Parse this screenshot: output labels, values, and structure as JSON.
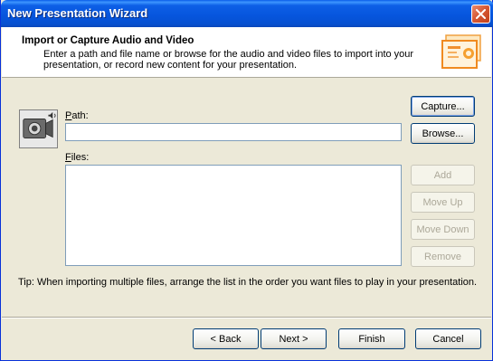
{
  "window": {
    "title": "New Presentation Wizard"
  },
  "header": {
    "title": "Import or Capture Audio and Video",
    "description": "Enter a path and file name or browse for the audio and video files to import into your presentation, or record new content for your presentation."
  },
  "icons": {
    "header": "presentation-slides-icon",
    "media": "camera-audio-icon",
    "close": "close-icon"
  },
  "form": {
    "path_label_mnemonic": "P",
    "path_label_rest": "ath:",
    "path_value": "",
    "files_label_mnemonic": "F",
    "files_label_rest": "iles:"
  },
  "side_buttons": {
    "capture": "Capture...",
    "browse": "Browse...",
    "add": "Add",
    "move_up": "Move Up",
    "move_down": "Move Down",
    "remove": "Remove"
  },
  "tip": "Tip: When importing multiple files, arrange the list in the order you want files to play in your presentation.",
  "footer": {
    "back": "< Back",
    "next": "Next >",
    "finish": "Finish",
    "cancel": "Cancel"
  }
}
